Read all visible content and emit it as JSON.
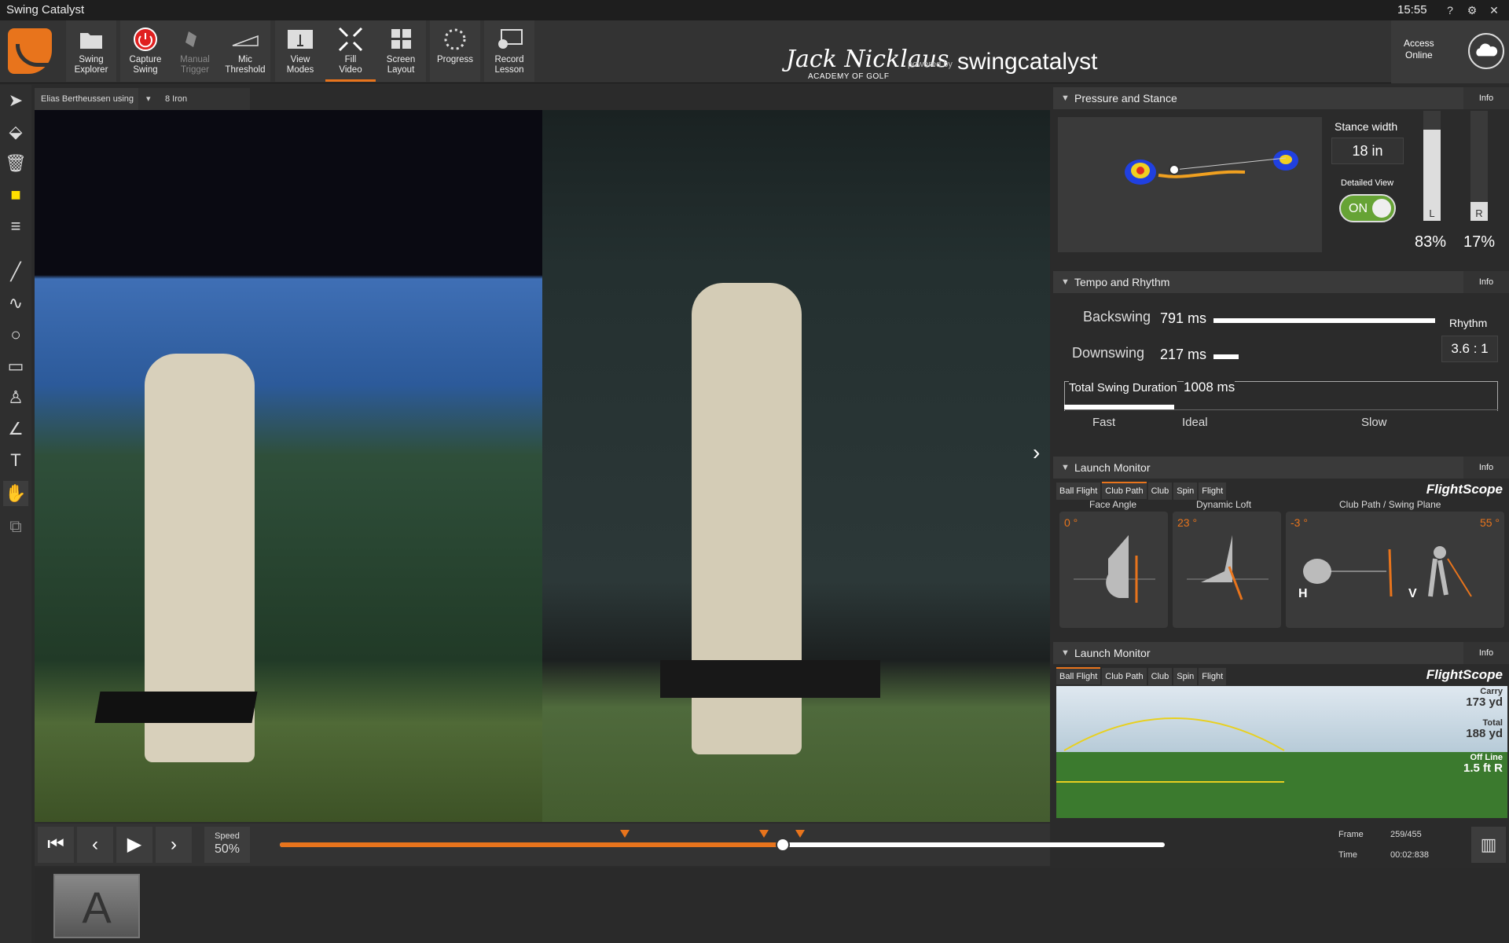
{
  "app": {
    "title": "Swing Catalyst",
    "clock": "15:55"
  },
  "window_controls": {
    "help": "?",
    "settings": "⚙",
    "close": "✕"
  },
  "toolbar": {
    "items": [
      {
        "label1": "Swing",
        "label2": "Explorer"
      },
      {
        "label1": "Capture",
        "label2": "Swing"
      },
      {
        "label1": "Manual",
        "label2": "Trigger"
      },
      {
        "label1": "Mic",
        "label2": "Threshold"
      },
      {
        "label1": "View",
        "label2": "Modes"
      },
      {
        "label1": "Fill",
        "label2": "Video"
      },
      {
        "label1": "Screen",
        "label2": "Layout"
      },
      {
        "label1": "Progress",
        "label2": ""
      },
      {
        "label1": "Record",
        "label2": "Lesson"
      }
    ],
    "brand": {
      "academy_name": "Jack Nicklaus",
      "academy_sub": "ACADEMY OF GOLF",
      "powered_by": "powered by",
      "product": "swingcatalyst"
    },
    "access": {
      "line1": "Access",
      "line2": "Online"
    }
  },
  "video": {
    "player": "Elias Bertheussen using",
    "club": "8 Iron"
  },
  "playback": {
    "speed_label": "Speed",
    "speed_value": "50%",
    "progress_fraction": 0.568,
    "markers": [
      0.39,
      0.547,
      0.588
    ],
    "frame_label": "Frame",
    "frame_value": "259/455",
    "time_label": "Time",
    "time_value": "00:02:838"
  },
  "thumbnails": [
    {
      "label": "A"
    }
  ],
  "panels": {
    "pressure": {
      "title": "Pressure and Stance",
      "info": "Info",
      "stance_width_label": "Stance width",
      "stance_width_value": "18 in",
      "detailed_view_label": "Detailed View",
      "toggle_label": "ON",
      "left_label": "L",
      "right_label": "R",
      "left_pct": "83%",
      "right_pct": "17%",
      "left_fraction": 0.83,
      "right_fraction": 0.17
    },
    "tempo": {
      "title": "Tempo and Rhythm",
      "info": "Info",
      "backswing_label": "Backswing",
      "backswing_value": "791 ms",
      "downswing_label": "Downswing",
      "downswing_value": "217 ms",
      "rhythm_label": "Rhythm",
      "rhythm_value": "3.6 : 1",
      "total_label": "Total Swing Duration",
      "total_value": "1008 ms",
      "fast": "Fast",
      "ideal": "Ideal",
      "slow": "Slow"
    },
    "launch1": {
      "title": "Launch Monitor",
      "info": "Info",
      "tabs": [
        "Ball Flight",
        "Club Path",
        "Club",
        "Spin",
        "Flight"
      ],
      "selected_tab": "Club Path",
      "brand": "FlightScope",
      "face_angle_label": "Face Angle",
      "face_angle_value": "0 °",
      "dynamic_loft_label": "Dynamic Loft",
      "dynamic_loft_value": "23 °",
      "club_path_label": "Club Path / Swing Plane",
      "club_path_value": "-3 °",
      "swing_plane_value": "55 °",
      "h_label": "H",
      "v_label": "V"
    },
    "launch2": {
      "title": "Launch Monitor",
      "info": "Info",
      "tabs": [
        "Ball Flight",
        "Club Path",
        "Club",
        "Spin",
        "Flight"
      ],
      "selected_tab": "Ball Flight",
      "brand": "FlightScope",
      "carry_label": "Carry",
      "carry_value": "173 yd",
      "total_label": "Total",
      "total_value": "188 yd",
      "offline_label": "Off Line",
      "offline_value": "1.5 ft R"
    }
  },
  "colors": {
    "accent": "#e8741c",
    "toggle_on": "#66a335",
    "bg": "#2b2b2b"
  }
}
